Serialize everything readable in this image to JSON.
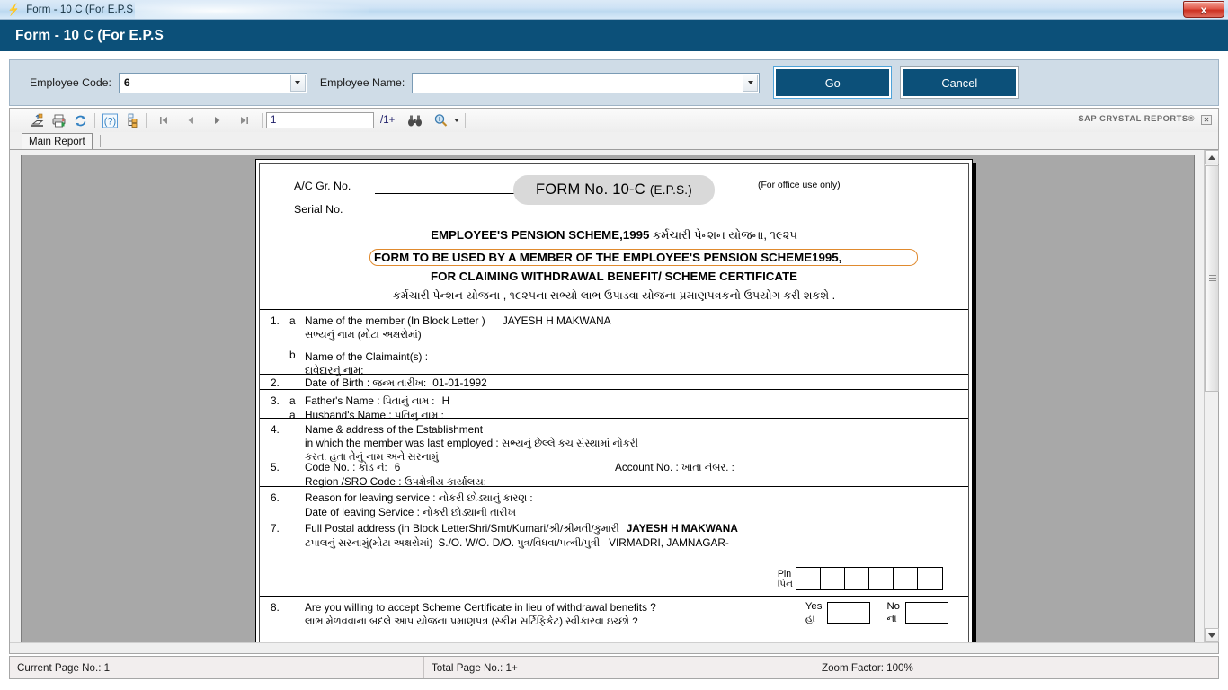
{
  "window": {
    "os_title": "Form - 10 C (For E.P.S",
    "bolt_icon": "lightning-icon",
    "close_label": "x"
  },
  "header": {
    "title": "Form - 10 C (For E.P.S"
  },
  "criteria": {
    "employee_code_label": "Employee Code:",
    "employee_code_value": "6",
    "employee_name_label": "Employee Name:",
    "employee_name_value": "",
    "go_label": "Go",
    "cancel_label": "Cancel"
  },
  "toolbar": {
    "icons": [
      "export-icon",
      "print-icon",
      "refresh-icon",
      "help-icon",
      "group-tree-icon"
    ],
    "nav": [
      "first-page-icon",
      "previous-page-icon",
      "next-page-icon",
      "last-page-icon"
    ],
    "page_number": "1",
    "total_pages": "/1+",
    "search_icon": "binoculars-icon",
    "zoom_icon": "zoom-icon",
    "brand": "SAP CRYSTAL REPORTS",
    "brand_mark": "®",
    "close_label": "✕"
  },
  "tabs": {
    "main_report": "Main Report"
  },
  "status": {
    "current_page": "Current Page No.: 1",
    "total_page": "Total Page No.: 1+",
    "zoom_factor": "Zoom Factor: 100%"
  },
  "report": {
    "ac_gr_no_label": "A/C Gr. No.",
    "serial_no_label": "Serial No.",
    "form_badge": "FORM No. 10-C",
    "form_badge_sub": "(E.P.S.)",
    "office_use": "(For office use only)",
    "scheme_title_en": "EMPLOYEE'S PENSION SCHEME,1995",
    "scheme_title_gu": "કર્મચારી પેન્શન યોજના, ૧૯૨૫",
    "usage_line1": "FORM TO BE USED BY A MEMBER OF THE EMPLOYEE'S PENSION SCHEME1995,",
    "usage_line2": "FOR CLAIMING WITHDRAWAL BENEFIT/ SCHEME CERTIFICATE",
    "usage_line_gu": "કર્મચારી પેન્શન યોજના , ૧૯૨૫ના સભ્યો લાભ ઉપાડવા  યોજના પ્રમાણપત્રકનો ઉપયોગ કરી શકશે .",
    "rows": [
      {
        "num": "1.",
        "sub_a": "a",
        "a_en": "Name of the member (In Block Letter )",
        "a_value": "JAYESH H MAKWANA",
        "a_gu": "સભ્યનું નામ (મોટા અક્ષરોમાં)",
        "sub_b": "b",
        "b_en": "Name of the Claimaint(s) :",
        "b_gu": "દાવેદારનું નામ:"
      },
      {
        "num": "2.",
        "label_en": "Date of Birth : ",
        "label_gu": "જન્મ તારીખ: ",
        "value": "01-01-1992"
      },
      {
        "num": "3.",
        "sub_a": "a",
        "a_en": "Father's Name : ",
        "a_gu": "પિતાનું નામ : ",
        "a_value": "H",
        "sub_b": "a",
        "b_en": "Husband's Name : ",
        "b_gu": "પતિનું નામ :"
      },
      {
        "num": "4.",
        "line1": "Name & address of the Establishment",
        "line2_en": "in which the member was last employed : ",
        "line2_gu": "સભ્યનું છેલ્લે કચ સંસ્થામાં નોકરી",
        "line3_gu": "કરતા હતા તેનું નામ અને સરનામું"
      },
      {
        "num": "5.",
        "code_en": "Code No. : ",
        "code_gu": "કોડ નં: ",
        "code_value": "6",
        "account_en": "Account No. : ",
        "account_gu": "ખાતા નંબર. :",
        "region_en": "Region /SRO Code : ",
        "region_gu": "ઉપક્ષેત્રીય કાર્યાલય:"
      },
      {
        "num": "6.",
        "reason_en": "Reason for leaving service : ",
        "reason_gu": "નોકરી છોડ્યાનું કારણ :",
        "date_en": "Date of leaving Service : ",
        "date_gu": "નોકરી છોડ્યાની તારીખ"
      },
      {
        "num": "7.",
        "line1_en": "Full Postal address (in Block LetterShri/Smt/Kumari/",
        "line1_gu": "શ્રી/શ્રીમતી/કુમારી",
        "line1_value": "JAYESH H MAKWANA",
        "line2_gu": "ટપાલનું સરનામું(મોટા અક્ષરોમાં)",
        "line2_en": "S./O. W/O. D/O. ",
        "line2_gu2": "પુત્ર/વિધવા/પત્ની/પુત્રી",
        "line2_value": "VIRMADRI, JAMNAGAR-",
        "pin_en": "Pin",
        "pin_gu": "પિન",
        "pin_cells": [
          "",
          "",
          "",
          "",
          "",
          ""
        ]
      },
      {
        "num": "8.",
        "q_en": "Are you willing to accept Scheme Certificate in lieu of withdrawal benefits ?",
        "q_gu": "લાભ મેળવવાના બદલે આપ યોજના પ્રમાણપત્ર (સ્કીમ સર્ટિફિકેટ) સ્વીકારવા ઇચ્છો ?",
        "yes_en": "Yes",
        "yes_gu": "હા",
        "no_en": "No",
        "no_gu": "ના"
      }
    ]
  },
  "colors": {
    "header_blue": "#0c5079",
    "panel_blue": "#cfdce7",
    "report_gray": "#a8a8a8",
    "highlight_orange": "#e08a2e"
  }
}
